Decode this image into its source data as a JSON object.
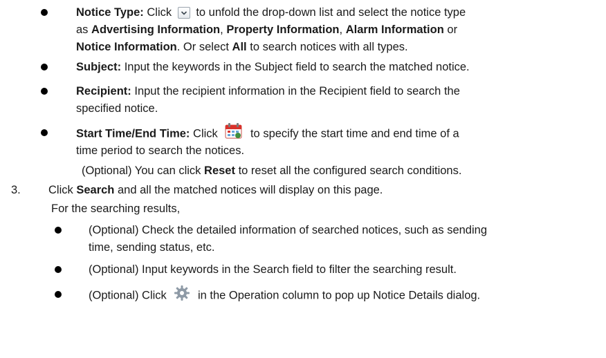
{
  "notice_type": {
    "label": "Notice Type:",
    "p1": "Click",
    "p2": "to unfold the drop-down list and select the notice type",
    "p3": "as",
    "opt1": "Advertising Information",
    "sep1": ",",
    "opt2": "Property Information",
    "sep2": ",",
    "opt3": "Alarm Information",
    "p4": "or",
    "opt4": "Notice Information",
    "p5": ". Or select",
    "all": "All",
    "p6": "to search notices with all types."
  },
  "subject": {
    "label": "Subject:",
    "text": "Input the keywords in the Subject field to search the matched notice."
  },
  "recipient": {
    "label": "Recipient:",
    "text1": "Input the recipient information in the Recipient field to search the",
    "text2": "specified notice."
  },
  "time": {
    "label": "Start Time/End Time:",
    "p1": "Click",
    "p2": "to specify the start time and end time of a",
    "p3": "time period to search the notices."
  },
  "reset": {
    "p1": "(Optional) You can click",
    "bold": "Reset",
    "p2": "to reset all the configured search conditions."
  },
  "step3": {
    "number": "3.",
    "p1": "Click",
    "bold": "Search",
    "p2": "and all the matched notices will display on this page."
  },
  "results_intro": "For the searching results,",
  "results": {
    "r1_line1": "(Optional) Check the detailed information of searched notices, such as sending",
    "r1_line2": "time, sending status, etc.",
    "r2": "(Optional) Input keywords in the Search field to filter the searching result.",
    "r3_p1": "(Optional) Click",
    "r3_p2": "in the Operation column to pop up Notice Details dialog."
  },
  "icons": {
    "dropdown": "dropdown-arrow-icon",
    "calendar": "calendar-icon",
    "gear": "gear-icon"
  },
  "colors": {
    "calendar_red": "#d9322b",
    "gear_gray": "#8e9aa6"
  }
}
